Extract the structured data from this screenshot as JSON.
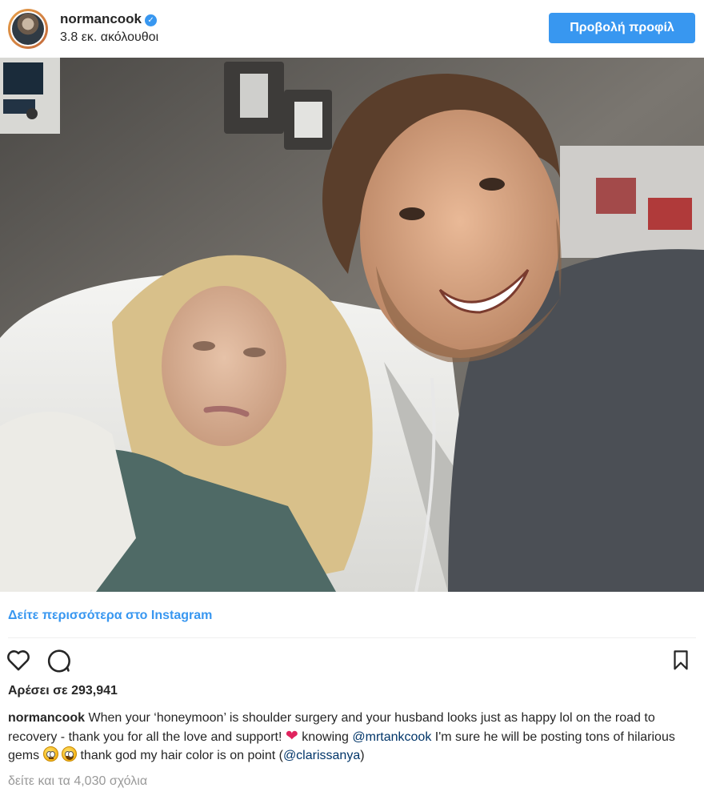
{
  "header": {
    "username": "normancook",
    "followers": "3.8 εκ. ακόλουθοι",
    "view_profile_label": "Προβολή προφίλ"
  },
  "post": {
    "see_more_label": "Δείτε περισσότερα στο Instagram",
    "likes": "Αρέσει σε 293,941",
    "caption": {
      "username": "normancook",
      "text_1": " When your ‘honeymoon’ is shoulder surgery and your husband looks just as happy lol on the road to recovery - thank you for all the love and support! ",
      "text_2": " knowing ",
      "mention_1": "@mrtankcook",
      "text_3": " I'm sure he will be posting tons of hilarious gems ",
      "text_4": " thank god my hair color is on point (",
      "mention_2": "@clarissanya",
      "text_5": ")"
    },
    "view_comments": "δείτε και τα 4,030 σχόλια"
  },
  "icons": {
    "like": "heart-outline-icon",
    "comment": "speech-bubble-icon",
    "save": "bookmark-icon",
    "verified": "verified-badge-icon",
    "emoji_1": "face-with-rolling-eyes",
    "emoji_2": "zany-face"
  },
  "colors": {
    "accent": "#3897f0",
    "text": "#262626",
    "muted": "#999999",
    "mention": "#003569",
    "heart": "#e0245e"
  }
}
